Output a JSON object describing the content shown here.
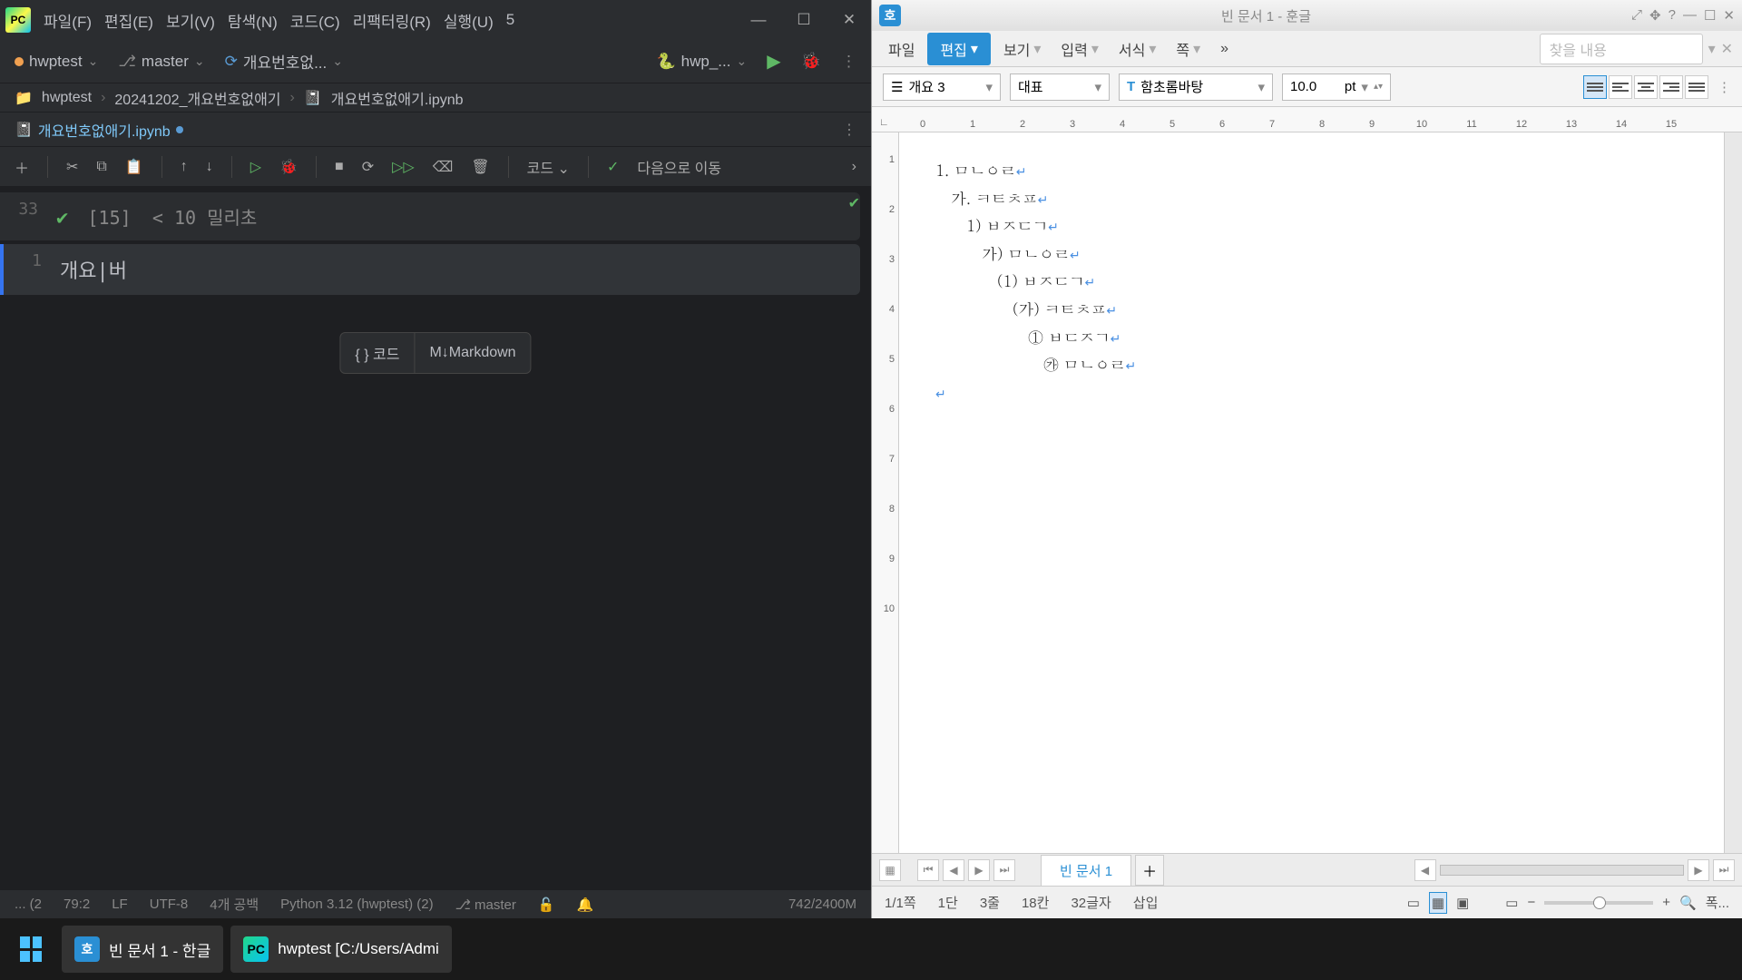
{
  "pycharm": {
    "menus": [
      "파일(F)",
      "편집(E)",
      "보기(V)",
      "탐색(N)",
      "코드(C)",
      "리팩터링(R)",
      "실행(U)"
    ],
    "menu_overflow": "5",
    "project": "hwptest",
    "branch": "master",
    "config_run": "개요번호없...",
    "interpreter": "hwp_...",
    "breadcrumb": [
      "hwptest",
      "20241202_개요번호없애기",
      "개요번호없애기.ipynb"
    ],
    "tab": "개요번호없애기.ipynb",
    "action_code": "코드",
    "action_next": "다음으로 이동",
    "cell_prev_num": "33",
    "cell_prev_exec": "[15]",
    "cell_prev_time": "< 10 밀리초",
    "cell_cur_num": "1",
    "cell_cur_text": "개요|버",
    "gen_code": "코드",
    "gen_md": "Markdown",
    "status": {
      "left": "... (2",
      "pos": "79:2",
      "le": "LF",
      "enc": "UTF-8",
      "spaces": "4개 공백",
      "py": "Python 3.12 (hwptest) (2)",
      "branch": "master",
      "mem": "742/2400M"
    }
  },
  "hangul": {
    "title": "빈 문서 1 - 훈글",
    "menus": [
      "파일",
      "편집",
      "보기",
      "입력",
      "서식",
      "쪽"
    ],
    "search_placeholder": "찾을 내용",
    "style": "개요 3",
    "lang": "대표",
    "font_icon": "T",
    "font": "함초롬바탕",
    "size": "10.0",
    "unit": "pt",
    "ruler_h": [
      "0",
      "1",
      "2",
      "3",
      "4",
      "5",
      "6",
      "7",
      "8",
      "9",
      "10",
      "11",
      "12",
      "13",
      "14",
      "15"
    ],
    "ruler_v": [
      "1",
      "2",
      "3",
      "4",
      "5",
      "6",
      "7",
      "8",
      "9",
      "10"
    ],
    "doc_lines": [
      "1. ㅁㄴㅇㄹ",
      "   가. ㅋㅌㅊㅍ",
      "      1) ㅂㅈㄷㄱ",
      "         가) ㅁㄴㅇㄹ",
      "            (1) ㅂㅈㄷㄱ",
      "               (가) ㅋㅌㅊㅍ",
      "                  ① ㅂㄷㅈㄱ",
      "                     ㉮ ㅁㄴㅇㄹ"
    ],
    "doc_tab": "빈 문서 1",
    "status": {
      "page": "1/1쪽",
      "dan": "1단",
      "line": "3줄",
      "col": "18칸",
      "chars": "32글자",
      "mode": "삽입",
      "zoom": "폭..."
    }
  },
  "taskbar": {
    "hangul": "빈 문서 1 - 한글",
    "pycharm": "hwptest [C:/Users/Admi"
  }
}
